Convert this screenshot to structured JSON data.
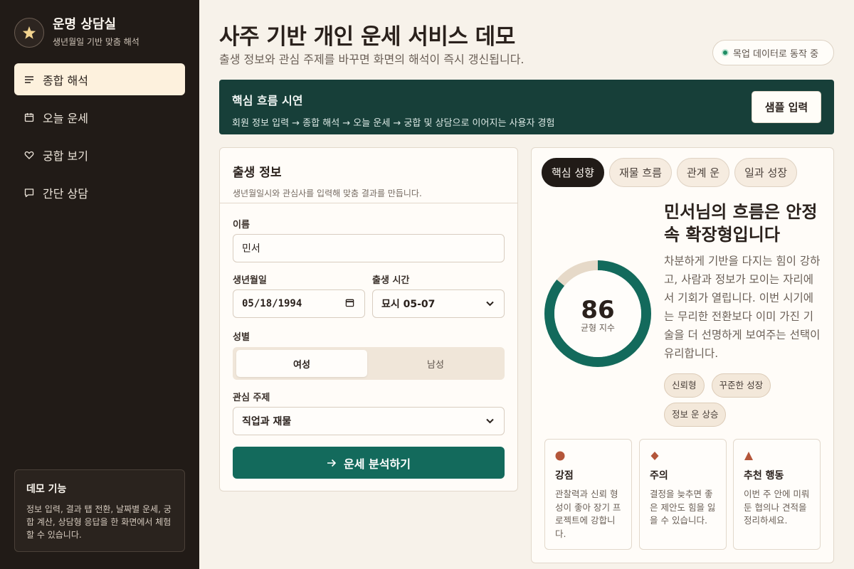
{
  "brand": {
    "title": "운명 상담실",
    "subtitle": "생년월일 기반 맞춤 해석"
  },
  "nav": [
    {
      "label": "종합 해석",
      "icon": "list-icon",
      "active": true
    },
    {
      "label": "오늘 운세",
      "icon": "calendar-icon",
      "active": false
    },
    {
      "label": "궁합 보기",
      "icon": "heart-icon",
      "active": false
    },
    {
      "label": "간단 상담",
      "icon": "chat-icon",
      "active": false
    }
  ],
  "demo": {
    "title": "데모 기능",
    "description": "정보 입력, 결과 탭 전환, 날짜별 운세, 궁합 계산, 상담형 응답을 한 화면에서 체험할 수 있습니다."
  },
  "header": {
    "title": "사주 기반 개인 운세 서비스 데모",
    "subtitle": "출생 정보와 관심 주제를 바꾸면 화면의 해석이 즉시 갱신됩니다.",
    "status": "목업 데이터로 동작 중"
  },
  "banner": {
    "title": "핵심 흐름 시연",
    "description": "회원 정보 입력 → 종합 해석 → 오늘 운세 → 궁합 및 상담으로 이어지는 사용자 경험",
    "button": "샘플 입력"
  },
  "form": {
    "title": "출생 정보",
    "description": "생년월일시와 관심사를 입력해 맞춤 결과를 만듭니다.",
    "name_label": "이름",
    "name_value": "민서",
    "birth_label": "생년월일",
    "birth_value": "05/18/1994",
    "time_label": "출생 시간",
    "time_value": "묘시 05-07",
    "gender_label": "성별",
    "gender_options": [
      "여성",
      "남성"
    ],
    "gender_selected": "여성",
    "topic_label": "관심 주제",
    "topic_value": "직업과 재물",
    "submit": "운세 분석하기"
  },
  "result": {
    "tabs": [
      {
        "label": "핵심 성향",
        "active": true
      },
      {
        "label": "재물 흐름",
        "active": false
      },
      {
        "label": "관계 운",
        "active": false
      },
      {
        "label": "일과 성장",
        "active": false
      }
    ],
    "score": 86,
    "score_max": 100,
    "score_label": "균형 지수",
    "title": "민서님의 흐름은 안정 속 확장형입니다",
    "description": "차분하게 기반을 다지는 힘이 강하고, 사람과 정보가 모이는 자리에서 기회가 열립니다. 이번 시기에는 무리한 전환보다 이미 가진 기술을 더 선명하게 보여주는 선택이 유리합니다.",
    "tags": [
      "신뢰형",
      "꾸준한 성장",
      "정보 운 상승"
    ],
    "cards": [
      {
        "icon": "circle-icon",
        "color": "#b4563a",
        "title": "강점",
        "text": "관찰력과 신뢰 형성이 좋아 장기 프로젝트에 강합니다."
      },
      {
        "icon": "diamond-icon",
        "color": "#b4563a",
        "title": "주의",
        "text": "결정을 늦추면 좋은 제안도 힘을 잃을 수 있습니다."
      },
      {
        "icon": "triangle-icon",
        "color": "#b4563a",
        "title": "추천 행동",
        "text": "이번 주 안에 미뤄둔 협의나 견적을 정리하세요."
      }
    ]
  },
  "colors": {
    "accent": "#136a5c",
    "sidebar": "#211b17",
    "banner": "#173f39",
    "warm": "#b4563a"
  }
}
